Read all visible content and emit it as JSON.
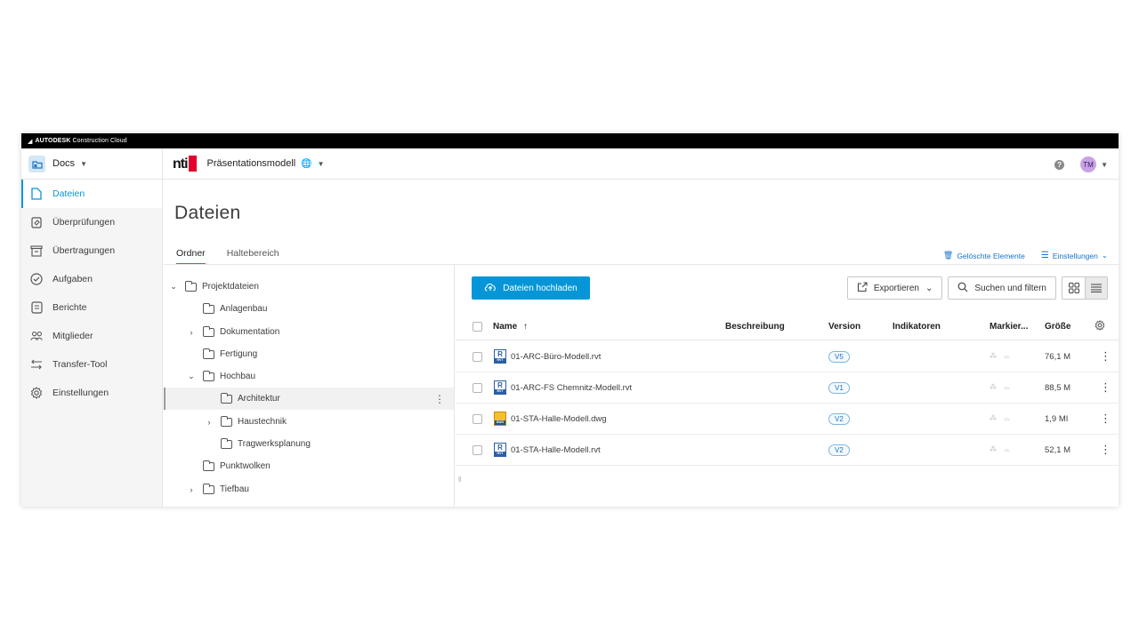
{
  "topbar": {
    "brand": "AUTODESK",
    "product": "Construction Cloud"
  },
  "header": {
    "module": "Docs",
    "logo_text": "nti",
    "project": "Präsentationsmodell",
    "avatar": "TM",
    "help": "?"
  },
  "sidebar": {
    "items": [
      {
        "label": "Dateien",
        "icon": "file-icon"
      },
      {
        "label": "Überprüfungen",
        "icon": "review-icon"
      },
      {
        "label": "Übertragungen",
        "icon": "transmittal-icon"
      },
      {
        "label": "Aufgaben",
        "icon": "check-circle-icon"
      },
      {
        "label": "Berichte",
        "icon": "report-icon"
      },
      {
        "label": "Mitglieder",
        "icon": "members-icon"
      },
      {
        "label": "Transfer-Tool",
        "icon": "transfer-icon"
      },
      {
        "label": "Einstellungen",
        "icon": "gear-icon"
      }
    ]
  },
  "main": {
    "title": "Dateien",
    "tabs": [
      "Ordner",
      "Haltebereich"
    ],
    "deleted_items": "Gelöschte Elemente",
    "settings": "Einstellungen"
  },
  "tree": [
    {
      "label": "Projektdateien",
      "expanded": true
    },
    {
      "label": "Anlagenbau"
    },
    {
      "label": "Dokumentation",
      "collapsed": true
    },
    {
      "label": "Fertigung"
    },
    {
      "label": "Hochbau",
      "expanded": true
    },
    {
      "label": "Architektur",
      "selected": true
    },
    {
      "label": "Haustechnik",
      "collapsed": true
    },
    {
      "label": "Tragwerksplanung"
    },
    {
      "label": "Punktwolken"
    },
    {
      "label": "Tiefbau",
      "collapsed": true
    }
  ],
  "toolbar": {
    "upload": "Dateien hochladen",
    "export": "Exportieren",
    "search": "Suchen und filtern"
  },
  "table": {
    "columns": [
      "Name",
      "Beschreibung",
      "Version",
      "Indikatoren",
      "Markier...",
      "Größe"
    ],
    "sort_indicator": "↑",
    "rows": [
      {
        "name": "01-ARC-Büro-Modell.rvt",
        "type": "rvt",
        "version": "V5",
        "size": "76,1 M"
      },
      {
        "name": "01-ARC-FS Chemnitz-Modell.rvt",
        "type": "rvt",
        "version": "V1",
        "size": "88,5 M"
      },
      {
        "name": "01-STA-Halle-Modell.dwg",
        "type": "dwg",
        "version": "V2",
        "size": "1,9 MI"
      },
      {
        "name": "01-STA-Halle-Modell.rvt",
        "type": "rvt",
        "version": "V2",
        "size": "52,1 M"
      }
    ]
  },
  "colors": {
    "accent": "#0696d7",
    "brand_red": "#e3002d"
  }
}
